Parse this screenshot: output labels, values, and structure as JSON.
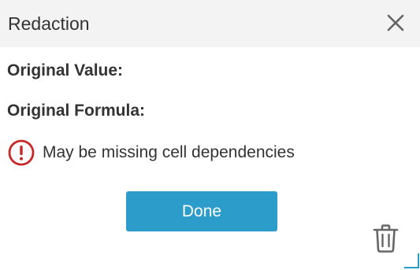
{
  "dialog": {
    "title": "Redaction",
    "close_icon": "close-icon",
    "fields": {
      "original_value_label": "Original Value:",
      "original_formula_label": "Original Formula:"
    },
    "warning": {
      "icon": "exclamation-circle-icon",
      "text": "May be missing cell dependencies"
    },
    "done_label": "Done",
    "delete_icon": "trash-icon",
    "resize_icon": "resize-handle-icon"
  },
  "colors": {
    "header_bg": "#f3f3f3",
    "text": "#333333",
    "warning_red": "#c62828",
    "button_blue": "#2c9ccb",
    "button_text": "#ffffff",
    "icon_gray": "#666666"
  }
}
